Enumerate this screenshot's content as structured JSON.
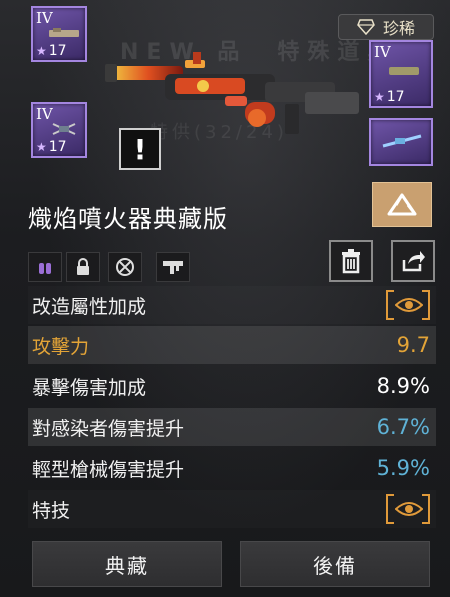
{
  "background_text": {
    "tab_fragment": "NEW 品　特殊道具",
    "sub_fragment": "特供(32/24)"
  },
  "parts": [
    {
      "tier": "IV",
      "level": "17"
    },
    {
      "tier": "IV",
      "level": "17"
    },
    {
      "tier": "IV",
      "level": "17"
    },
    {
      "tier": "",
      "level": ""
    }
  ],
  "rarity": {
    "label": "珍稀",
    "icon": "diamond-icon"
  },
  "alert": {
    "symbol": "!"
  },
  "weapon": {
    "name": "熾焰噴火器典藏版"
  },
  "modules": [
    "ammo-icon",
    "lock-icon",
    "no-scope-icon",
    "smg-icon"
  ],
  "actions": {
    "delete_icon": "trash-icon",
    "share_icon": "share-icon",
    "drive_icon": "drive-icon"
  },
  "stats": {
    "header_label": "改造屬性加成",
    "rows": [
      {
        "label": "攻擊力",
        "value": "9.7"
      },
      {
        "label": "暴擊傷害加成",
        "value": "8.9%"
      },
      {
        "label": "對感染者傷害提升",
        "value": "6.7%"
      },
      {
        "label": "輕型槍械傷害提升",
        "value": "5.9%"
      }
    ],
    "skill_label": "特技"
  },
  "buttons": {
    "collect": "典藏",
    "reserve": "後備"
  },
  "colors": {
    "part_bg": "#5a4590",
    "attack_label": "#e3a437",
    "attack_value": "#e3a437",
    "crit_value": "#ffffff",
    "blue_value": "#5fb2d6",
    "eye_accent": "#e09a3a",
    "drive_bg": "#c9a070"
  }
}
